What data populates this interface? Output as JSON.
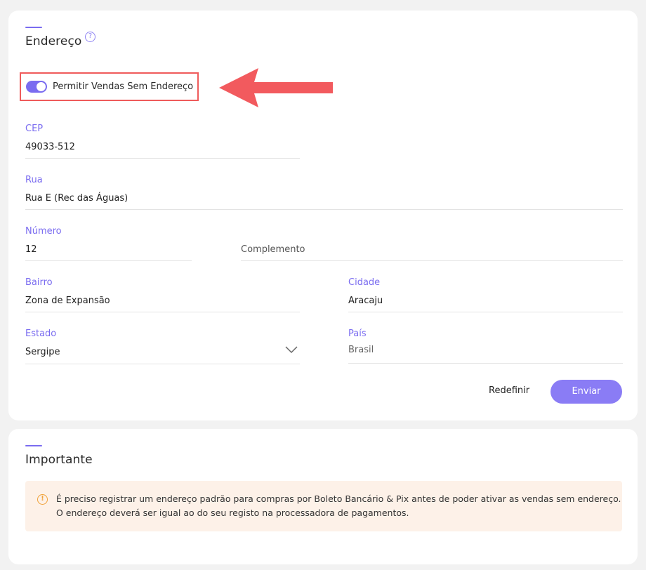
{
  "address_card": {
    "title": "Endereço",
    "help_icon": "?",
    "toggle": {
      "label": "Permitir Vendas Sem Endereço",
      "checked": true
    },
    "fields": {
      "cep": {
        "label": "CEP",
        "value": "49033-512"
      },
      "rua": {
        "label": "Rua",
        "value": "Rua E (Rec das Águas)"
      },
      "numero": {
        "label": "Número",
        "value": "12"
      },
      "complemento": {
        "placeholder": "Complemento"
      },
      "bairro": {
        "label": "Bairro",
        "value": "Zona de Expansão"
      },
      "cidade": {
        "label": "Cidade",
        "value": "Aracaju"
      },
      "estado": {
        "label": "Estado",
        "value": "Sergipe"
      },
      "pais": {
        "label": "País",
        "value": "Brasil"
      }
    },
    "buttons": {
      "reset": "Redefinir",
      "send": "Enviar"
    }
  },
  "important_card": {
    "title": "Importante",
    "notice_icon": "!",
    "notice_line1": "É preciso registrar um endereço padrão para compras por Boleto Bancário & Pix antes de poder ativar as vendas sem endereço.",
    "notice_line2": "O endereço deverá ser igual ao do seu registo na processadora de pagamentos."
  },
  "colors": {
    "accent": "#7a6cf0",
    "button": "#8a7cf5",
    "annotation": "#ef5b5b",
    "notice_bg": "#fdf1e8",
    "notice_icon": "#f0a23a"
  },
  "icons": {
    "help": "question-circle-icon",
    "chevron": "chevron-down-icon",
    "notice": "info-circle-icon",
    "annotation_arrow": "red-arrow-left-icon"
  }
}
